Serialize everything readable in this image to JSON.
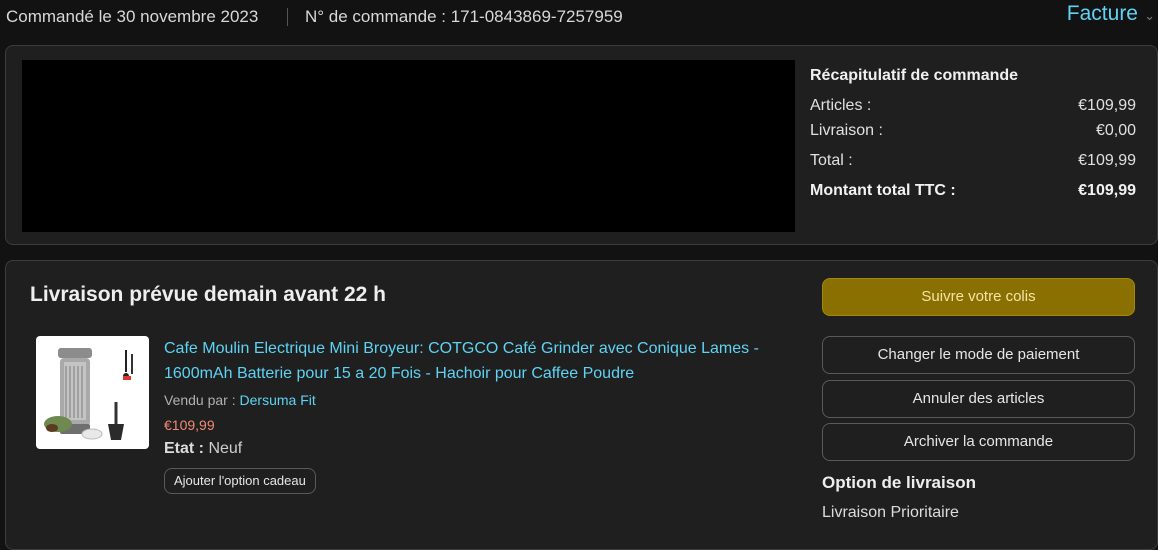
{
  "header": {
    "order_date": "Commandé le 30 novembre 2023",
    "order_number": "N° de commande : 171-0843869-7257959",
    "invoice_label": "Facture",
    "invoice_icon": "chevron-down-icon"
  },
  "summary": {
    "title": "Récapitulatif de commande",
    "rows": [
      {
        "label": "Articles :",
        "value": "€109,99"
      },
      {
        "label": "Livraison :",
        "value": "€0,00"
      },
      {
        "label": "Total :",
        "value": "€109,99"
      },
      {
        "label": "Montant total TTC :",
        "value": "€109,99"
      }
    ]
  },
  "delivery": {
    "title": "Livraison prévue demain avant 22 h",
    "product": {
      "title": "Cafe Moulin Electrique Mini Broyeur: COTGCO Café Grinder avec Conique Lames - 1600mAh Batterie pour 15 a 20 Fois - Hachoir pour Caffee Poudre",
      "seller_label": "Vendu par :",
      "seller_name": "Dersuma Fit",
      "price": "€109,99",
      "condition_label": "Etat :",
      "condition_value": "Neuf",
      "gift_button": "Ajouter l'option cadeau"
    },
    "actions": {
      "track": "Suivre votre colis",
      "change_payment": "Changer le mode de paiement",
      "cancel": "Annuler des articles",
      "archive": "Archiver la commande"
    },
    "option_title": "Option de livraison",
    "option_value": "Livraison Prioritaire"
  },
  "colors": {
    "background": "#121212",
    "card": "#1f1f1f",
    "link": "#5ed3f3",
    "price": "#f08b72",
    "primary_button": "#8a7000"
  }
}
